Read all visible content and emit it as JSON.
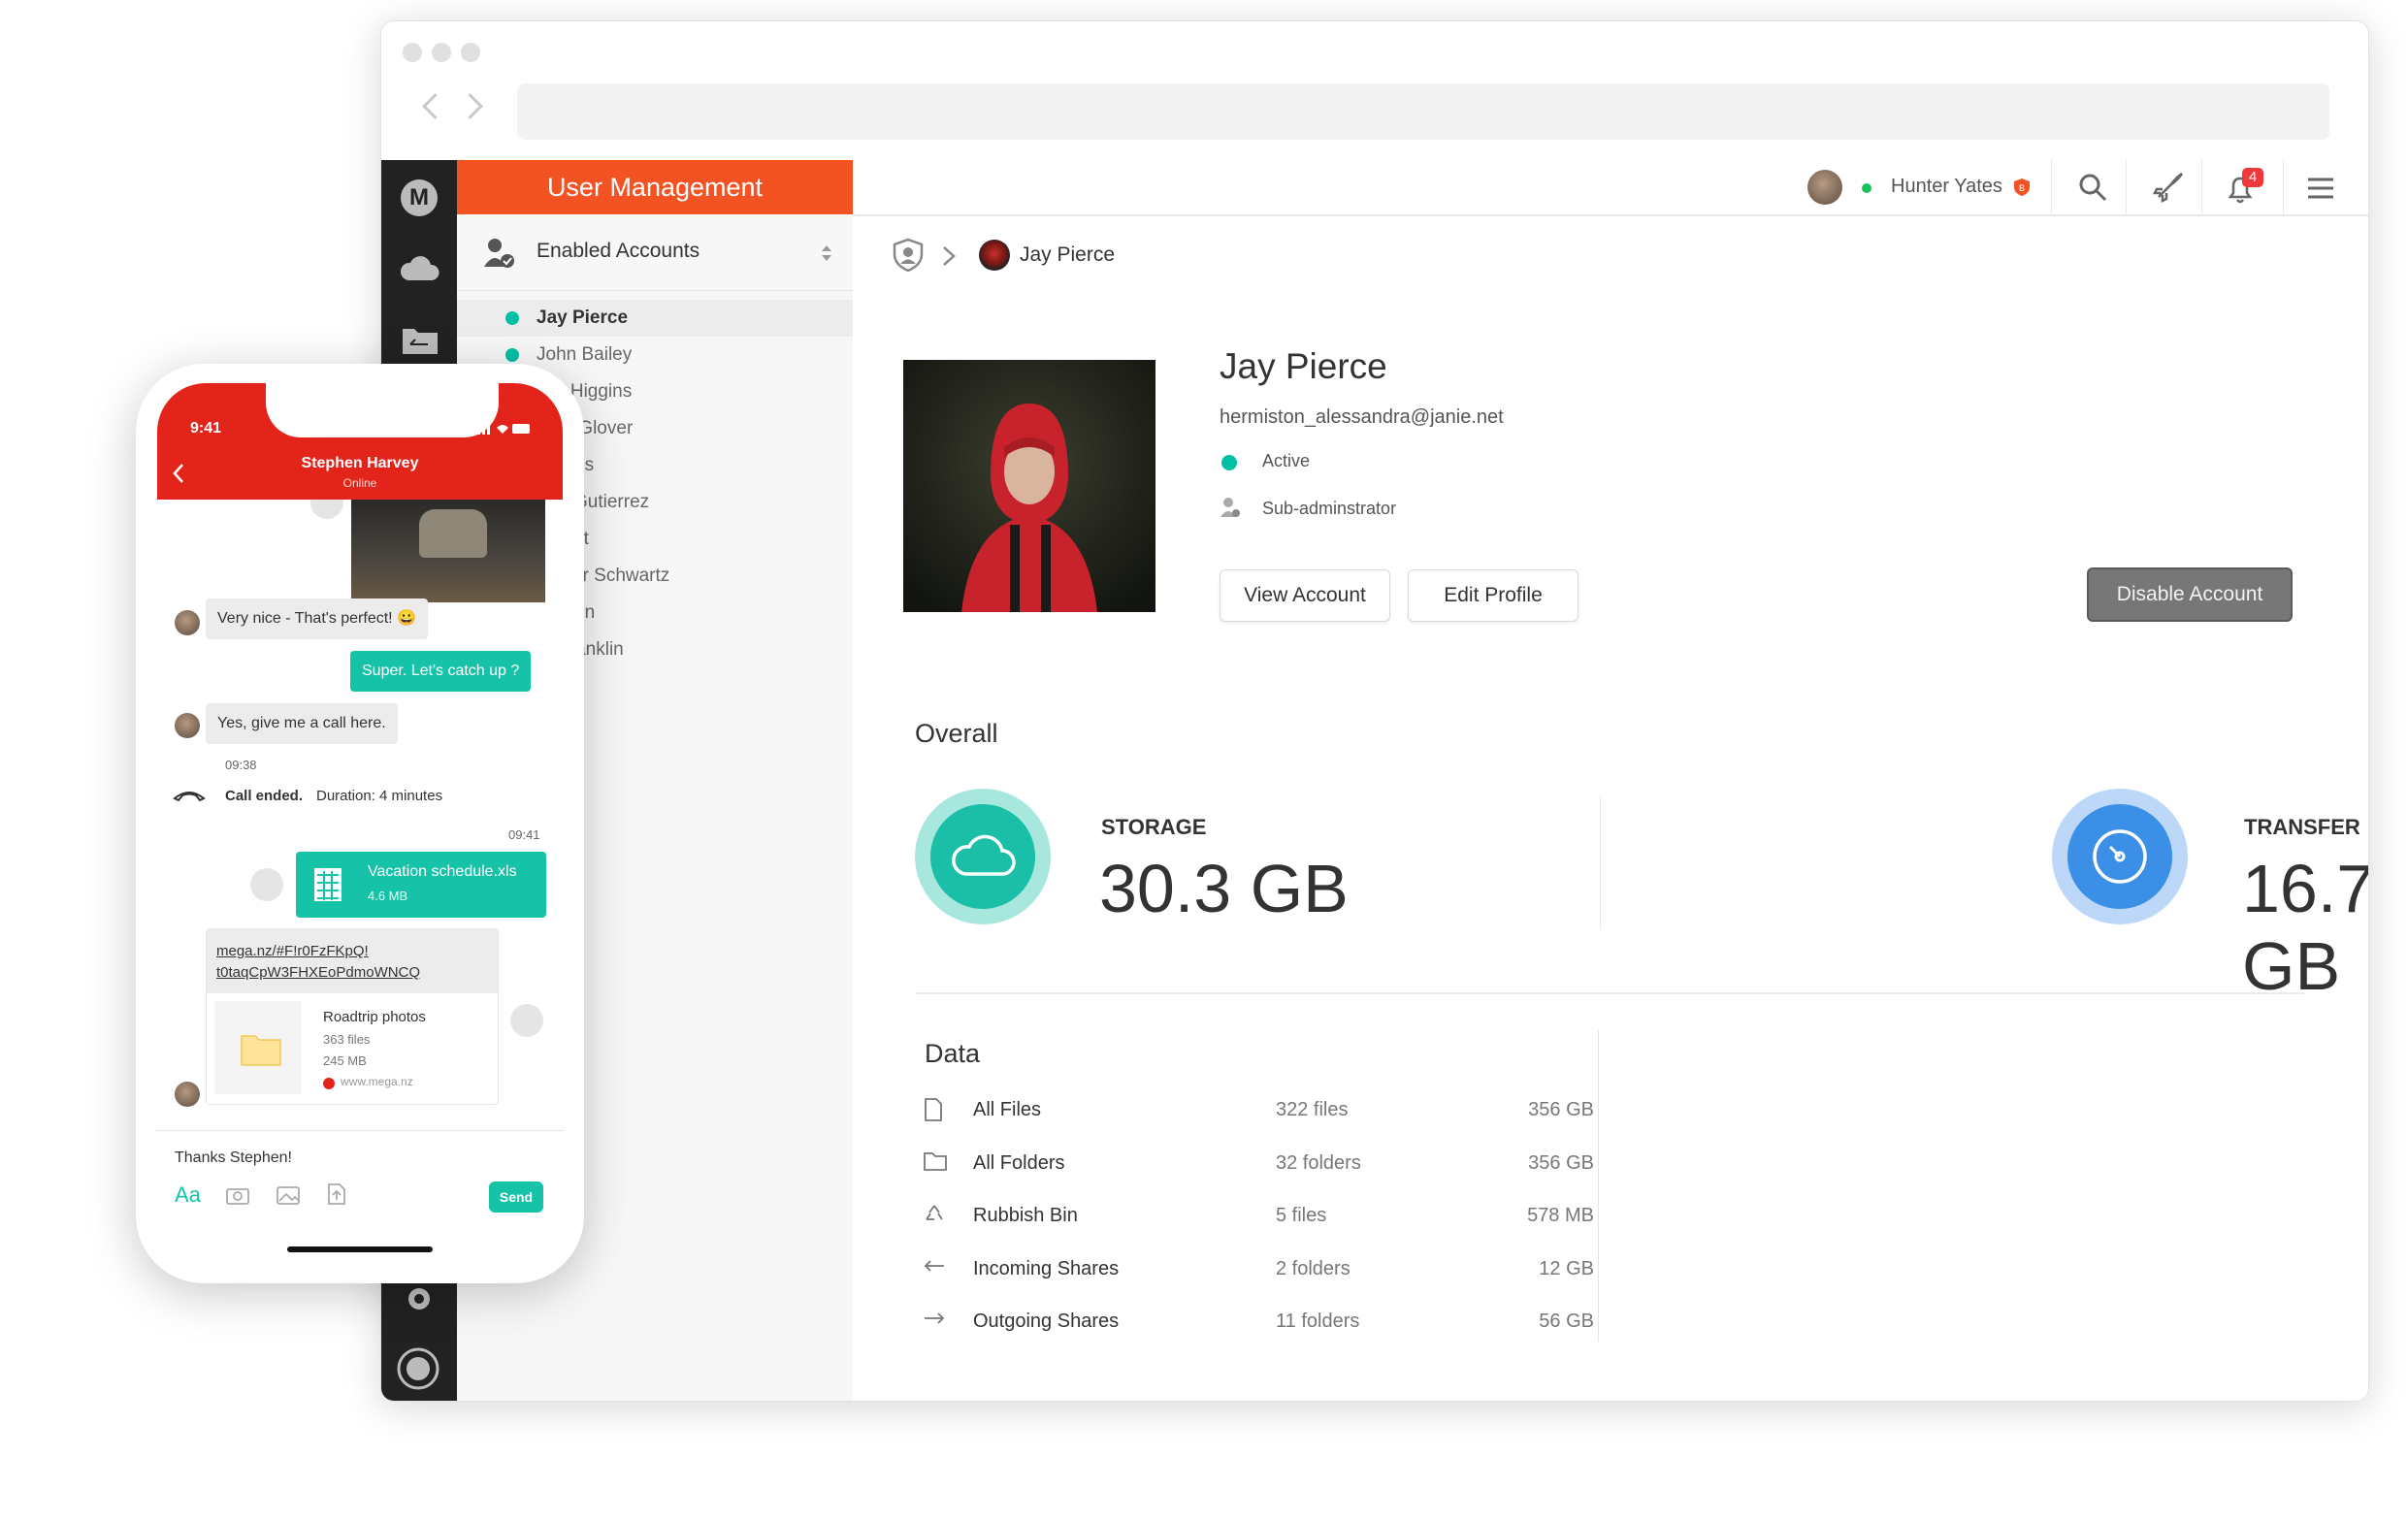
{
  "browser": {
    "url": ""
  },
  "sidebar": {
    "header": "User Management",
    "filter_label": "Enabled Accounts",
    "users": [
      {
        "name": "Jay Pierce",
        "selected": true,
        "active": true
      },
      {
        "name": "John Bailey",
        "selected": false,
        "active": true
      },
      {
        "name": "alie Higgins",
        "selected": false,
        "active": false
      },
      {
        "name": "dore Glover",
        "selected": false,
        "active": false
      },
      {
        "name": "Santos",
        "selected": false,
        "active": false
      },
      {
        "name": "aret Gutierrez",
        "selected": false,
        "active": false
      },
      {
        "name": "ie Holt",
        "selected": false,
        "active": false
      },
      {
        "name": "topher Schwartz",
        "selected": false,
        "active": false
      },
      {
        "name": "Gibson",
        "selected": false,
        "active": false
      },
      {
        "name": "er Franklin",
        "selected": false,
        "active": false
      }
    ]
  },
  "topbar": {
    "user_name": "Hunter Yates",
    "notification_count": "4"
  },
  "breadcrumb": {
    "current": "Jay Pierce"
  },
  "profile": {
    "name": "Jay Pierce",
    "email": "hermiston_alessandra@janie.net",
    "status": "Active",
    "role": "Sub-adminstrator",
    "view_account": "View Account",
    "edit_profile": "Edit Profile",
    "disable_account": "Disable Account"
  },
  "overall": {
    "title": "Overall",
    "storage_label": "STORAGE",
    "storage_value": "30.3 GB",
    "transfer_label": "TRANSFER",
    "transfer_value": "16.7 GB"
  },
  "data": {
    "title": "Data",
    "rows": [
      {
        "label": "All Files",
        "count": "322 files",
        "size": "356 GB",
        "icon": "file-icon"
      },
      {
        "label": "All Folders",
        "count": "32 folders",
        "size": "356 GB",
        "icon": "folder-icon"
      },
      {
        "label": "Rubbish Bin",
        "count": "5 files",
        "size": "578 MB",
        "icon": "recycle-icon"
      },
      {
        "label": "Incoming Shares",
        "count": "2 folders",
        "size": "12 GB",
        "icon": "arrow-left-icon"
      },
      {
        "label": "Outgoing Shares",
        "count": "11 folders",
        "size": "56 GB",
        "icon": "arrow-right-icon"
      }
    ]
  },
  "phone": {
    "time": "9:41",
    "contact_name": "Stephen Harvey",
    "contact_status": "Online",
    "msg1": "Very nice - That's perfect! 😀",
    "msg2": "Super. Let's catch up ?",
    "msg3": "Yes, give me a call here.",
    "time1": "09:38",
    "call_ended": "Call ended.",
    "call_duration": "Duration: 4 minutes",
    "time2": "09:41",
    "file_name": "Vacation schedule.xls",
    "file_size": "4.6 MB",
    "link_line1": "mega.nz/#F!r0FzFKpQ!",
    "link_line2": "t0taqCpW3FHXEoPdmoWNCQ",
    "folder_name": "Roadtrip photos",
    "folder_files": "363 files",
    "folder_size": "245 MB",
    "folder_site": "www.mega.nz",
    "input_text": "Thanks Stephen!",
    "aa_label": "Aa",
    "send_label": "Send"
  },
  "colors": {
    "brand": "#f35322",
    "teal": "#00bfa5",
    "blue": "#3b8fe6",
    "phone_red": "#e3241a"
  }
}
